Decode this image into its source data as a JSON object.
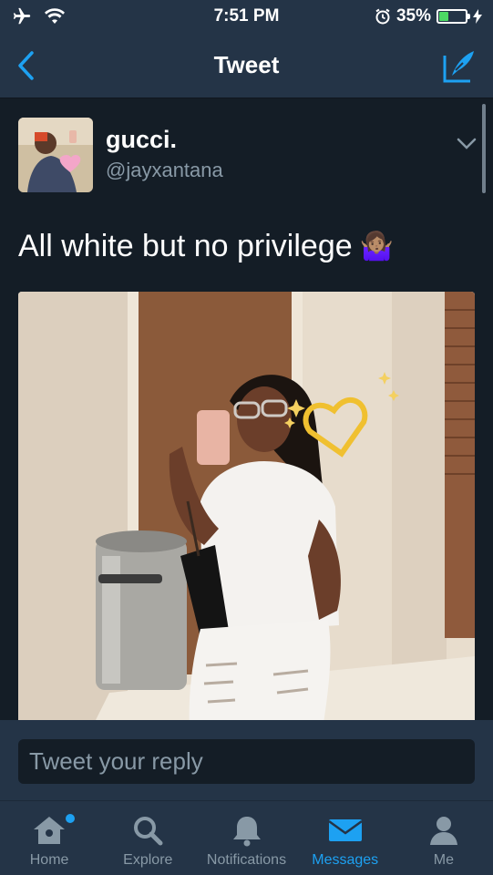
{
  "status_bar": {
    "time": "7:51 PM",
    "battery_text": "35%",
    "battery_level": 0.35
  },
  "nav": {
    "title": "Tweet"
  },
  "tweet": {
    "display_name": "gucci.",
    "handle": "@jayxantana",
    "text": "All white but no privilege",
    "emoji": "🤷🏽‍♀️"
  },
  "reply": {
    "placeholder": "Tweet your reply"
  },
  "tabs": [
    {
      "label": "Home",
      "icon": "home-icon"
    },
    {
      "label": "Explore",
      "icon": "search-icon"
    },
    {
      "label": "Notifications",
      "icon": "bell-icon"
    },
    {
      "label": "Messages",
      "icon": "envelope-icon"
    },
    {
      "label": "Me",
      "icon": "person-icon"
    }
  ],
  "colors": {
    "accent": "#1da1f2",
    "background": "#141d26",
    "header": "#243447",
    "secondary_text": "#8899a6"
  }
}
